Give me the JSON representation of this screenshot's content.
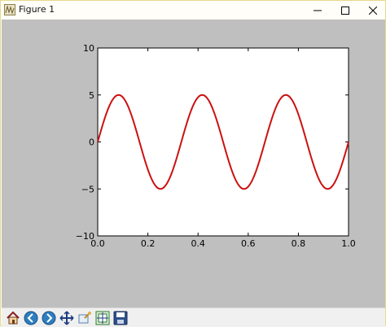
{
  "window": {
    "title": "Figure 1"
  },
  "chart_data": {
    "type": "line",
    "title": "",
    "xlabel": "",
    "ylabel": "",
    "xlim": [
      0.0,
      1.0
    ],
    "ylim": [
      -10,
      10
    ],
    "xticks": [
      "0.0",
      "0.2",
      "0.4",
      "0.6",
      "0.8",
      "1.0"
    ],
    "yticks": [
      "10",
      "5",
      "0",
      "−5",
      "−10"
    ],
    "grid": false,
    "series": [
      {
        "amplitude": 5,
        "frequency": 3,
        "phase": 0,
        "color": "#cc1111"
      }
    ]
  },
  "toolbar": {
    "items": [
      "home-icon",
      "back-icon",
      "forward-icon",
      "pan-icon",
      "zoom-icon",
      "subplots-icon",
      "save-icon"
    ]
  }
}
